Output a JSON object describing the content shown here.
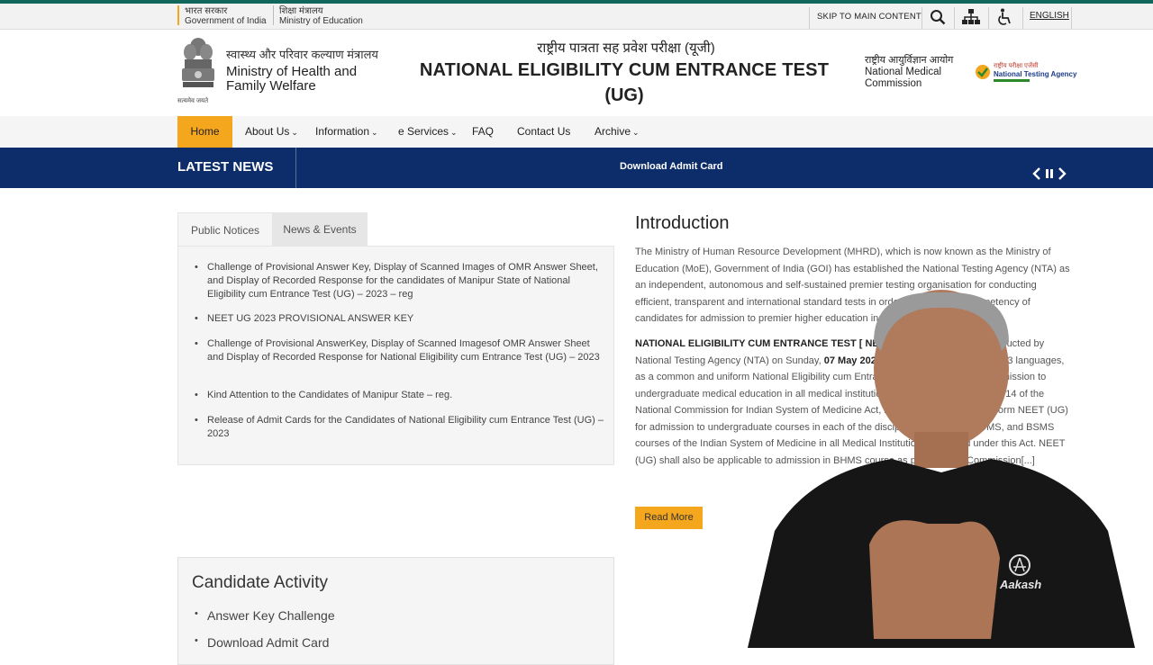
{
  "gov_bar": {
    "gov_india_hindi": "भारत सरकार",
    "gov_india": "Government of India",
    "moe_hindi": "शिक्षा मंत्रालय",
    "moe": "Ministry of Education",
    "skip": "SKIP TO MAIN CONTENT",
    "language": "ENGLISH"
  },
  "header": {
    "ministry_hindi": "स्वास्थ्य और परिवार कल्याण मंत्रालय",
    "ministry_line1": "Ministry of Health and",
    "ministry_line2": "Family Welfare",
    "emblem_motto": "सत्यमेव जयते",
    "title_hindi": "राष्ट्रीय पात्रता सह प्रवेश परीक्षा (यूजी)",
    "title_line1": "NATIONAL ELIGIBILITY CUM ENTRANCE TEST",
    "title_line2": "(UG)",
    "nmc_hindi": "राष्ट्रीय आयुर्विज्ञान आयोग",
    "nmc_line1": "National Medical",
    "nmc_line2": "Commission",
    "nta_hindi": "राष्ट्रीय परीक्षा एजेंसी",
    "nta": "National Testing Agency"
  },
  "nav": {
    "home": "Home",
    "about": "About Us",
    "information": "Information",
    "eservices": "e Services",
    "faq": "FAQ",
    "contact": "Contact Us",
    "archive": "Archive"
  },
  "news": {
    "label": "LATEST NEWS",
    "ticker": "Download Admit Card"
  },
  "tabs": {
    "public_notices": "Public Notices",
    "news_events": "News & Events"
  },
  "notices": [
    "Challenge of Provisional Answer Key, Display of Scanned Images of OMR Answer Sheet, and Display of Recorded Response for the candidates of Manipur State of National Eligibility cum Entrance Test (UG) – 2023 – reg",
    "NEET UG 2023 PROVISIONAL ANSWER KEY",
    "Challenge of Provisional AnswerKey, Display of Scanned Imagesof OMR Answer Sheet and Display of Recorded Response for National Eligibility cum Entrance Test (UG) – 2023",
    "Kind Attention to the Candidates of Manipur State – reg.",
    "Release of Admit Cards for the Candidates of National Eligibility cum Entrance Test (UG) – 2023"
  ],
  "intro": {
    "heading": "Introduction",
    "para1": "The Ministry of Human Resource Development (MHRD), which is now known as the Ministry of Education (MoE), Government of India (GOI) has established the National Testing Agency (NTA) as an independent, autonomous and self-sustained premier testing organisation for conducting efficient, transparent and international standard tests in order to assess the competency of candidates for admission to premier higher education institutions.",
    "para2_bold": "NATIONAL ELIGIBILITY CUM ENTRANCE TEST [ NEET (UG)] – 2023",
    "para2_a": " will be conducted by National Testing Agency (NTA) on Sunday, ",
    "para2_date": "07 May 2023",
    "para2_b": " in Pen and Paper mode in 13 languages, as a common and uniform National Eligibility cum Entrance Test [NEET (UG)] for admission to undergraduate medical education in all medical institutions. Similarly, as per Section 14 of the National Commission for Indian System of Medicine Act, 2020, there shall be a uniform NEET (UG) for admission to undergraduate courses in each of the disciplines i.e. BAMS, BUMS, and BSMS courses of the Indian System of Medicine in all Medical Institutions governed under this Act. NEET (UG) shall also be applicable to admission in BHMS course as per National Commission[...]",
    "read_more": "Read More"
  },
  "activity": {
    "heading": "Candidate Activity",
    "items": [
      "Answer Key Challenge",
      "Download Admit Card"
    ]
  },
  "overlay": {
    "shirt_brand": "Aakash"
  },
  "colors": {
    "accent": "#f4a61d",
    "news_bar": "#0c2d6a",
    "top_stripe": "#12675c"
  }
}
